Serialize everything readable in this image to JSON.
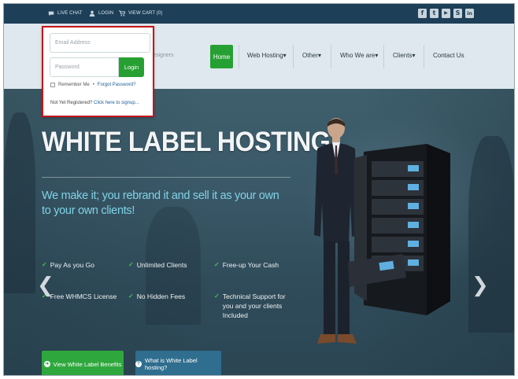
{
  "topbar": {
    "live_chat": "LIVE CHAT",
    "login": "LOGIN",
    "view_cart": "VIEW CART (0)",
    "social": [
      {
        "name": "facebook-icon",
        "glyph": "f"
      },
      {
        "name": "twitter-icon",
        "glyph": "t"
      },
      {
        "name": "youtube-icon",
        "glyph": "▶"
      },
      {
        "name": "skype-icon",
        "glyph": "S"
      },
      {
        "name": "linkedin-icon",
        "glyph": "in"
      }
    ]
  },
  "login_form": {
    "email_placeholder": "Email Address",
    "password_placeholder": "Password",
    "login_button": "Login",
    "remember_me": "Remember Me",
    "separator": "•",
    "forgot_password": "Forgot Password?",
    "not_registered": "Not Yet Registered?",
    "signup_link": "Click here to signup..."
  },
  "header": {
    "tagline_fragment": "Designers"
  },
  "nav": {
    "home": "Home",
    "web_hosting": "Web Hosting",
    "other": "Other",
    "who_we_are": "Who We are",
    "clients": "Clients",
    "contact_us": "Contact Us",
    "caret": "▾"
  },
  "hero": {
    "title": "WHITE LABEL HOSTING",
    "subtitle": "We make it; you rebrand it and sell it as your own to your own clients!",
    "features": [
      "Pay As you Go",
      "Unlimited Clients",
      "Free-up Your Cash",
      "Free WHMCS License",
      "No Hidden Fees",
      "Technical Support for you and your clients Included"
    ],
    "prev_arrow": "❮",
    "next_arrow": "❯",
    "cta_benefits": "View White Label Benefits",
    "cta_what": "What is White Label hosting?"
  },
  "colors": {
    "topbar": "#1d3f58",
    "accent_green": "#27a033",
    "cta_blue": "#2f6e8f",
    "highlight_red": "#c4161c",
    "subtitle_cyan": "#7fd3e6"
  }
}
